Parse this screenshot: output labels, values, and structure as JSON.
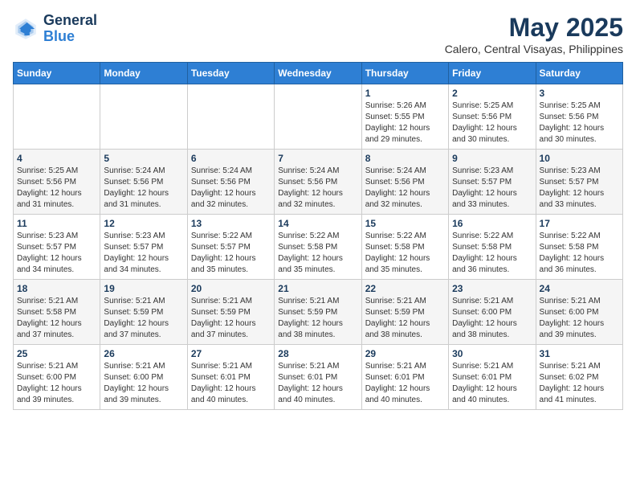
{
  "logo": {
    "line1": "General",
    "line2": "Blue"
  },
  "title": "May 2025",
  "subtitle": "Calero, Central Visayas, Philippines",
  "weekdays": [
    "Sunday",
    "Monday",
    "Tuesday",
    "Wednesday",
    "Thursday",
    "Friday",
    "Saturday"
  ],
  "weeks": [
    [
      {
        "day": "",
        "detail": ""
      },
      {
        "day": "",
        "detail": ""
      },
      {
        "day": "",
        "detail": ""
      },
      {
        "day": "",
        "detail": ""
      },
      {
        "day": "1",
        "detail": "Sunrise: 5:26 AM\nSunset: 5:55 PM\nDaylight: 12 hours\nand 29 minutes."
      },
      {
        "day": "2",
        "detail": "Sunrise: 5:25 AM\nSunset: 5:56 PM\nDaylight: 12 hours\nand 30 minutes."
      },
      {
        "day": "3",
        "detail": "Sunrise: 5:25 AM\nSunset: 5:56 PM\nDaylight: 12 hours\nand 30 minutes."
      }
    ],
    [
      {
        "day": "4",
        "detail": "Sunrise: 5:25 AM\nSunset: 5:56 PM\nDaylight: 12 hours\nand 31 minutes."
      },
      {
        "day": "5",
        "detail": "Sunrise: 5:24 AM\nSunset: 5:56 PM\nDaylight: 12 hours\nand 31 minutes."
      },
      {
        "day": "6",
        "detail": "Sunrise: 5:24 AM\nSunset: 5:56 PM\nDaylight: 12 hours\nand 32 minutes."
      },
      {
        "day": "7",
        "detail": "Sunrise: 5:24 AM\nSunset: 5:56 PM\nDaylight: 12 hours\nand 32 minutes."
      },
      {
        "day": "8",
        "detail": "Sunrise: 5:24 AM\nSunset: 5:56 PM\nDaylight: 12 hours\nand 32 minutes."
      },
      {
        "day": "9",
        "detail": "Sunrise: 5:23 AM\nSunset: 5:57 PM\nDaylight: 12 hours\nand 33 minutes."
      },
      {
        "day": "10",
        "detail": "Sunrise: 5:23 AM\nSunset: 5:57 PM\nDaylight: 12 hours\nand 33 minutes."
      }
    ],
    [
      {
        "day": "11",
        "detail": "Sunrise: 5:23 AM\nSunset: 5:57 PM\nDaylight: 12 hours\nand 34 minutes."
      },
      {
        "day": "12",
        "detail": "Sunrise: 5:23 AM\nSunset: 5:57 PM\nDaylight: 12 hours\nand 34 minutes."
      },
      {
        "day": "13",
        "detail": "Sunrise: 5:22 AM\nSunset: 5:57 PM\nDaylight: 12 hours\nand 35 minutes."
      },
      {
        "day": "14",
        "detail": "Sunrise: 5:22 AM\nSunset: 5:58 PM\nDaylight: 12 hours\nand 35 minutes."
      },
      {
        "day": "15",
        "detail": "Sunrise: 5:22 AM\nSunset: 5:58 PM\nDaylight: 12 hours\nand 35 minutes."
      },
      {
        "day": "16",
        "detail": "Sunrise: 5:22 AM\nSunset: 5:58 PM\nDaylight: 12 hours\nand 36 minutes."
      },
      {
        "day": "17",
        "detail": "Sunrise: 5:22 AM\nSunset: 5:58 PM\nDaylight: 12 hours\nand 36 minutes."
      }
    ],
    [
      {
        "day": "18",
        "detail": "Sunrise: 5:21 AM\nSunset: 5:58 PM\nDaylight: 12 hours\nand 37 minutes."
      },
      {
        "day": "19",
        "detail": "Sunrise: 5:21 AM\nSunset: 5:59 PM\nDaylight: 12 hours\nand 37 minutes."
      },
      {
        "day": "20",
        "detail": "Sunrise: 5:21 AM\nSunset: 5:59 PM\nDaylight: 12 hours\nand 37 minutes."
      },
      {
        "day": "21",
        "detail": "Sunrise: 5:21 AM\nSunset: 5:59 PM\nDaylight: 12 hours\nand 38 minutes."
      },
      {
        "day": "22",
        "detail": "Sunrise: 5:21 AM\nSunset: 5:59 PM\nDaylight: 12 hours\nand 38 minutes."
      },
      {
        "day": "23",
        "detail": "Sunrise: 5:21 AM\nSunset: 6:00 PM\nDaylight: 12 hours\nand 38 minutes."
      },
      {
        "day": "24",
        "detail": "Sunrise: 5:21 AM\nSunset: 6:00 PM\nDaylight: 12 hours\nand 39 minutes."
      }
    ],
    [
      {
        "day": "25",
        "detail": "Sunrise: 5:21 AM\nSunset: 6:00 PM\nDaylight: 12 hours\nand 39 minutes."
      },
      {
        "day": "26",
        "detail": "Sunrise: 5:21 AM\nSunset: 6:00 PM\nDaylight: 12 hours\nand 39 minutes."
      },
      {
        "day": "27",
        "detail": "Sunrise: 5:21 AM\nSunset: 6:01 PM\nDaylight: 12 hours\nand 40 minutes."
      },
      {
        "day": "28",
        "detail": "Sunrise: 5:21 AM\nSunset: 6:01 PM\nDaylight: 12 hours\nand 40 minutes."
      },
      {
        "day": "29",
        "detail": "Sunrise: 5:21 AM\nSunset: 6:01 PM\nDaylight: 12 hours\nand 40 minutes."
      },
      {
        "day": "30",
        "detail": "Sunrise: 5:21 AM\nSunset: 6:01 PM\nDaylight: 12 hours\nand 40 minutes."
      },
      {
        "day": "31",
        "detail": "Sunrise: 5:21 AM\nSunset: 6:02 PM\nDaylight: 12 hours\nand 41 minutes."
      }
    ]
  ]
}
